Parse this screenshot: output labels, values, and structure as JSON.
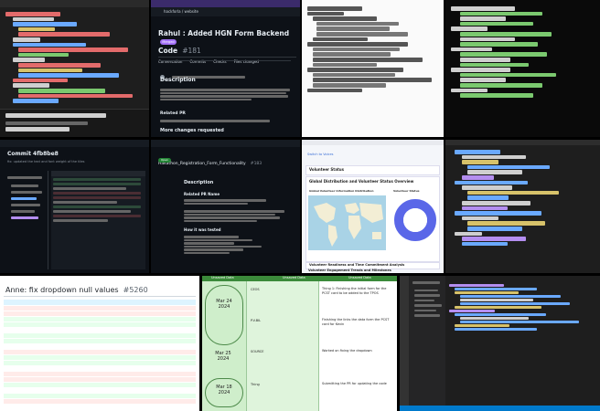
{
  "tile2": {
    "repo_path": "hackforla / website",
    "pr_title": "Rahul : Added HGN Form Backend Code",
    "pr_number": "#181",
    "status_badge": "Merged",
    "tabs": [
      "Conversation",
      "Commits",
      "Checks",
      "Files changed"
    ],
    "section_heading": "Description",
    "related_heading": "Related PR",
    "more_text": "More changes requested"
  },
  "tile5": {
    "title": "Commit 4fb8be8",
    "subtitle": "fix: updated the text and font weight of the tiles"
  },
  "tile6": {
    "pr_title": "Hakathon_Registration_Form_Functionality",
    "pr_number": "#183",
    "status_badge": "Open",
    "heading": "Description",
    "heading2": "Related PR Name",
    "heading3": "How it was tested"
  },
  "tile7": {
    "top_link": "Switch to Voices",
    "section1": "Volunteer Status",
    "section2": "Global Distribution and Volunteer Status Overview",
    "map_caption": "Global Volunteer Information Distribution",
    "donut_caption": "Volunteer Status",
    "section3": "Volunteer Readiness and Time Commitment Analysis",
    "section4": "Volunteer Engagement Trends and Milestones"
  },
  "tile9": {
    "title": "Anne: fix dropdown null values",
    "pr_number": "#5260"
  },
  "tile10": {
    "header_center": "Unsaved Data",
    "header_left": "Unsaved Data",
    "header_right": "Unsaved Data",
    "date1": "Mar 24",
    "date1_sub": "2024",
    "date2": "Mar 25",
    "date2_sub": "2024",
    "date3": "Mar 18",
    "date3_sub": "2024",
    "entries": [
      {
        "name": "CEOS",
        "note": "Thing 1: Finishing the initial form for the PCST card to be added to the TPOS"
      },
      {
        "name": "P.V.BIL",
        "note": "Finishing the links the data form the PCST card for Kevin"
      },
      {
        "name": "SOURCE",
        "note": "Worked on fixing the dropdown"
      },
      {
        "name": "Thing",
        "note": "Submitting the PR for updating the code"
      }
    ]
  }
}
